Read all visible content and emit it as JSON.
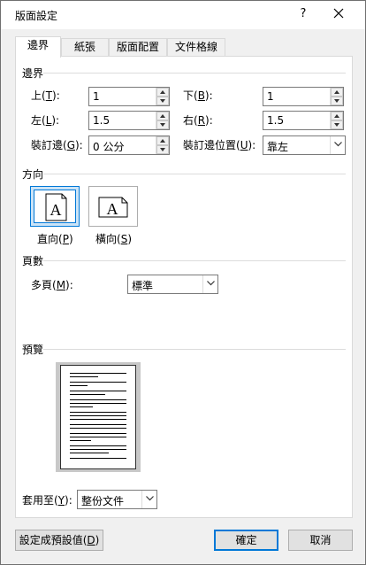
{
  "window": {
    "title": "版面設定",
    "help": "?"
  },
  "tabs": [
    {
      "label": "邊界"
    },
    {
      "label": "紙張"
    },
    {
      "label": "版面配置"
    },
    {
      "label": "文件格線"
    }
  ],
  "margins": {
    "section_label": "邊界",
    "top": {
      "label": "上(",
      "hotkey": "T",
      "suffix": "):",
      "value": "1"
    },
    "bottom": {
      "label": "下(",
      "hotkey": "B",
      "suffix": "):",
      "value": "1"
    },
    "left": {
      "label": "左(",
      "hotkey": "L",
      "suffix": "):",
      "value": "1.5"
    },
    "right": {
      "label": "右(",
      "hotkey": "R",
      "suffix": "):",
      "value": "1.5"
    },
    "gutter": {
      "label": "裝訂邊(",
      "hotkey": "G",
      "suffix": "):",
      "value": "0 公分"
    },
    "gutter_position": {
      "label": "裝訂邊位置(",
      "hotkey": "U",
      "suffix": "):",
      "value": "靠左"
    }
  },
  "orientation": {
    "section_label": "方向",
    "portrait": {
      "label": "直向(",
      "hotkey": "P",
      "suffix": ")",
      "glyph": "A"
    },
    "landscape": {
      "label": "橫向(",
      "hotkey": "S",
      "suffix": ")",
      "glyph": "A"
    }
  },
  "pages": {
    "section_label": "頁數",
    "multiple": {
      "label": "多頁(",
      "hotkey": "M",
      "suffix": "):",
      "value": "標準"
    }
  },
  "preview": {
    "section_label": "預覽"
  },
  "apply_to": {
    "label": "套用至(",
    "hotkey": "Y",
    "suffix": "):",
    "value": "整份文件"
  },
  "buttons": {
    "set_default": {
      "label": "設定成預設值(",
      "hotkey": "D",
      "suffix": ")"
    },
    "ok": "確定",
    "cancel": "取消"
  },
  "colors": {
    "accent": "#0078d7",
    "selected_bg": "#cce4f7"
  }
}
